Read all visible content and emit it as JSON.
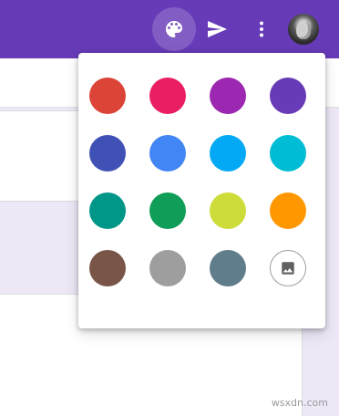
{
  "topbar": {
    "color": "#673ab7",
    "icons": [
      "palette-icon",
      "send-icon",
      "more-vert-icon"
    ]
  },
  "color_picker": {
    "rows": [
      [
        "#db4437",
        "#e91e63",
        "#9c27b0",
        "#673ab7"
      ],
      [
        "#3f51b5",
        "#4285f4",
        "#03a9f4",
        "#00bcd4"
      ],
      [
        "#009688",
        "#0f9d58",
        "#cddc39",
        "#ff9800"
      ],
      [
        "#795548",
        "#9e9e9e",
        "#607d8b",
        "image-icon"
      ]
    ]
  },
  "watermark": "wsxdn.com"
}
